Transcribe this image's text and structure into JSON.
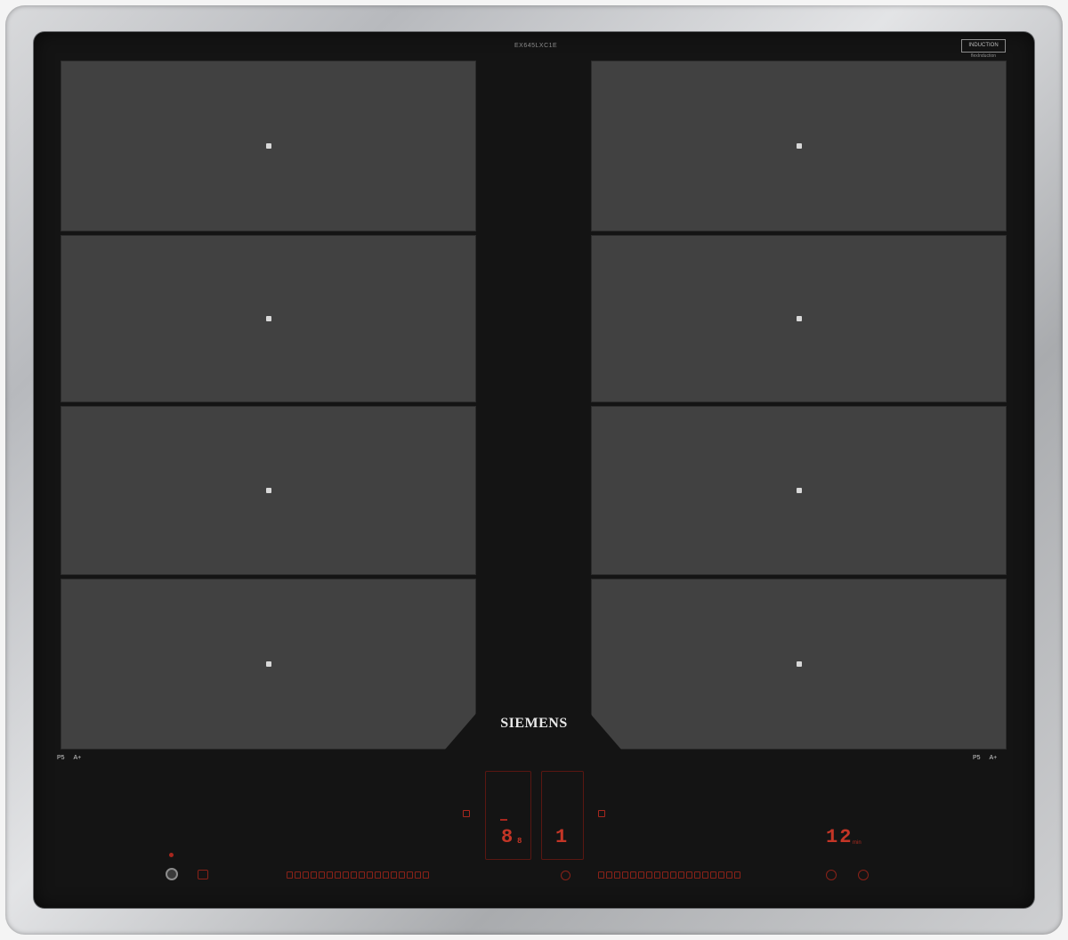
{
  "brand": "SIEMENS",
  "top_code": "EX645LXC1E",
  "badge": {
    "line1": "INDUCTION",
    "line2": "flexInduction"
  },
  "zone_labels": {
    "left": {
      "text1": "P5",
      "text2": "A+"
    },
    "right": {
      "text1": "P5",
      "text2": "A+"
    }
  },
  "cooktop": {
    "left_display": "8",
    "left_display_sub": "8",
    "right_display": "1",
    "timer_display": "12",
    "timer_unit": "min",
    "left_slider_segments": 18,
    "right_slider_segments": 18
  },
  "colors": {
    "glass": "#141414",
    "zone": "#414141",
    "led_red": "#c43526",
    "frame_steel": "#c4c6c9"
  },
  "icons": [
    "power-icon",
    "lock-icon",
    "timer-icon",
    "clock-icon",
    "flex-icon"
  ]
}
